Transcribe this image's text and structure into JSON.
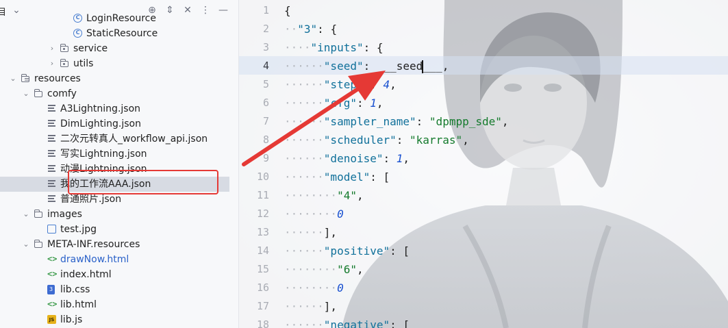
{
  "project_panel": {
    "title": "目",
    "tree": [
      {
        "label": "LoginResource",
        "icon": "class-icon",
        "depth": 6,
        "expanded": null
      },
      {
        "label": "StaticResource",
        "icon": "class-icon",
        "depth": 6,
        "expanded": null
      },
      {
        "label": "service",
        "icon": "package-icon",
        "depth": 5,
        "expanded": false
      },
      {
        "label": "utils",
        "icon": "package-icon",
        "depth": 5,
        "expanded": false
      },
      {
        "label": "resources",
        "icon": "resources-folder-icon",
        "depth": 2,
        "expanded": true
      },
      {
        "label": "comfy",
        "icon": "folder-icon",
        "depth": 3,
        "expanded": true
      },
      {
        "label": "A3Lightning.json",
        "icon": "json-file-icon",
        "depth": 4,
        "expanded": null
      },
      {
        "label": "DimLighting.json",
        "icon": "json-file-icon",
        "depth": 4,
        "expanded": null
      },
      {
        "label": "二次元转真人_workflow_api.json",
        "icon": "json-file-icon",
        "depth": 4,
        "expanded": null
      },
      {
        "label": "写实Lightning.json",
        "icon": "json-file-icon",
        "depth": 4,
        "expanded": null
      },
      {
        "label": "动漫Lightning.json",
        "icon": "json-file-icon",
        "depth": 4,
        "expanded": null
      },
      {
        "label": "我的工作流AAA.json",
        "icon": "json-file-icon",
        "depth": 4,
        "expanded": null,
        "selected": true
      },
      {
        "label": "普通照片.json",
        "icon": "json-file-icon",
        "depth": 4,
        "expanded": null
      },
      {
        "label": "images",
        "icon": "folder-icon",
        "depth": 3,
        "expanded": true
      },
      {
        "label": "test.jpg",
        "icon": "image-file-icon",
        "depth": 4,
        "expanded": null
      },
      {
        "label": "META-INF.resources",
        "icon": "folder-icon",
        "depth": 3,
        "expanded": true
      },
      {
        "label": "drawNow.html",
        "icon": "html-file-icon",
        "depth": 4,
        "expanded": null,
        "color": "#2b62c9"
      },
      {
        "label": "index.html",
        "icon": "html-file-icon",
        "depth": 4,
        "expanded": null
      },
      {
        "label": "lib.css",
        "icon": "css-file-icon",
        "depth": 4,
        "expanded": null
      },
      {
        "label": "lib.html",
        "icon": "html-file-icon",
        "depth": 4,
        "expanded": null
      },
      {
        "label": "lib.js",
        "icon": "js-file-icon",
        "depth": 4,
        "expanded": null
      }
    ]
  },
  "editor": {
    "current_line": 4,
    "lines": [
      {
        "n": "1",
        "parts": [
          [
            "p",
            "{"
          ]
        ]
      },
      {
        "n": "2",
        "parts": [
          [
            "d",
            "··"
          ],
          [
            "k",
            "\"3\""
          ],
          [
            "p",
            ": {"
          ]
        ]
      },
      {
        "n": "3",
        "parts": [
          [
            "d",
            "····"
          ],
          [
            "k",
            "\"inputs\""
          ],
          [
            "p",
            ": {"
          ]
        ]
      },
      {
        "n": "4",
        "parts": [
          [
            "d",
            "······"
          ],
          [
            "k",
            "\"seed\""
          ],
          [
            "p",
            ": ___seed___,"
          ]
        ]
      },
      {
        "n": "5",
        "parts": [
          [
            "d",
            "······"
          ],
          [
            "k",
            "\"steps\""
          ],
          [
            "p",
            ": "
          ],
          [
            "n",
            "4"
          ],
          [
            "p",
            ","
          ]
        ]
      },
      {
        "n": "6",
        "parts": [
          [
            "d",
            "······"
          ],
          [
            "k",
            "\"cfg\""
          ],
          [
            "p",
            ": "
          ],
          [
            "n",
            "1"
          ],
          [
            "p",
            ","
          ]
        ]
      },
      {
        "n": "7",
        "parts": [
          [
            "d",
            "······"
          ],
          [
            "k",
            "\"sampler_name\""
          ],
          [
            "p",
            ": "
          ],
          [
            "s",
            "\"dpmpp_sde\""
          ],
          [
            "p",
            ","
          ]
        ]
      },
      {
        "n": "8",
        "parts": [
          [
            "d",
            "······"
          ],
          [
            "k",
            "\"scheduler\""
          ],
          [
            "p",
            ": "
          ],
          [
            "s",
            "\"karras\""
          ],
          [
            "p",
            ","
          ]
        ]
      },
      {
        "n": "9",
        "parts": [
          [
            "d",
            "······"
          ],
          [
            "k",
            "\"denoise\""
          ],
          [
            "p",
            ": "
          ],
          [
            "n",
            "1"
          ],
          [
            "p",
            ","
          ]
        ]
      },
      {
        "n": "10",
        "parts": [
          [
            "d",
            "······"
          ],
          [
            "k",
            "\"model\""
          ],
          [
            "p",
            ": ["
          ]
        ]
      },
      {
        "n": "11",
        "parts": [
          [
            "d",
            "········"
          ],
          [
            "s",
            "\"4\""
          ],
          [
            "p",
            ","
          ]
        ]
      },
      {
        "n": "12",
        "parts": [
          [
            "d",
            "········"
          ],
          [
            "n",
            "0"
          ]
        ]
      },
      {
        "n": "13",
        "parts": [
          [
            "d",
            "······"
          ],
          [
            "p",
            "],"
          ]
        ]
      },
      {
        "n": "14",
        "parts": [
          [
            "d",
            "······"
          ],
          [
            "k",
            "\"positive\""
          ],
          [
            "p",
            ": ["
          ]
        ]
      },
      {
        "n": "15",
        "parts": [
          [
            "d",
            "········"
          ],
          [
            "s",
            "\"6\""
          ],
          [
            "p",
            ","
          ]
        ]
      },
      {
        "n": "16",
        "parts": [
          [
            "d",
            "········"
          ],
          [
            "n",
            "0"
          ]
        ]
      },
      {
        "n": "17",
        "parts": [
          [
            "d",
            "······"
          ],
          [
            "p",
            "],"
          ]
        ]
      },
      {
        "n": "18",
        "parts": [
          [
            "d",
            "······"
          ],
          [
            "k",
            "\"negative\""
          ],
          [
            "p",
            ": ["
          ]
        ]
      }
    ]
  },
  "colors": {
    "accent_highlight": "#e53935",
    "selection": "#d7dbe3",
    "json_key": "#10709a",
    "json_string": "#147a2c",
    "json_number": "#1850d0"
  }
}
